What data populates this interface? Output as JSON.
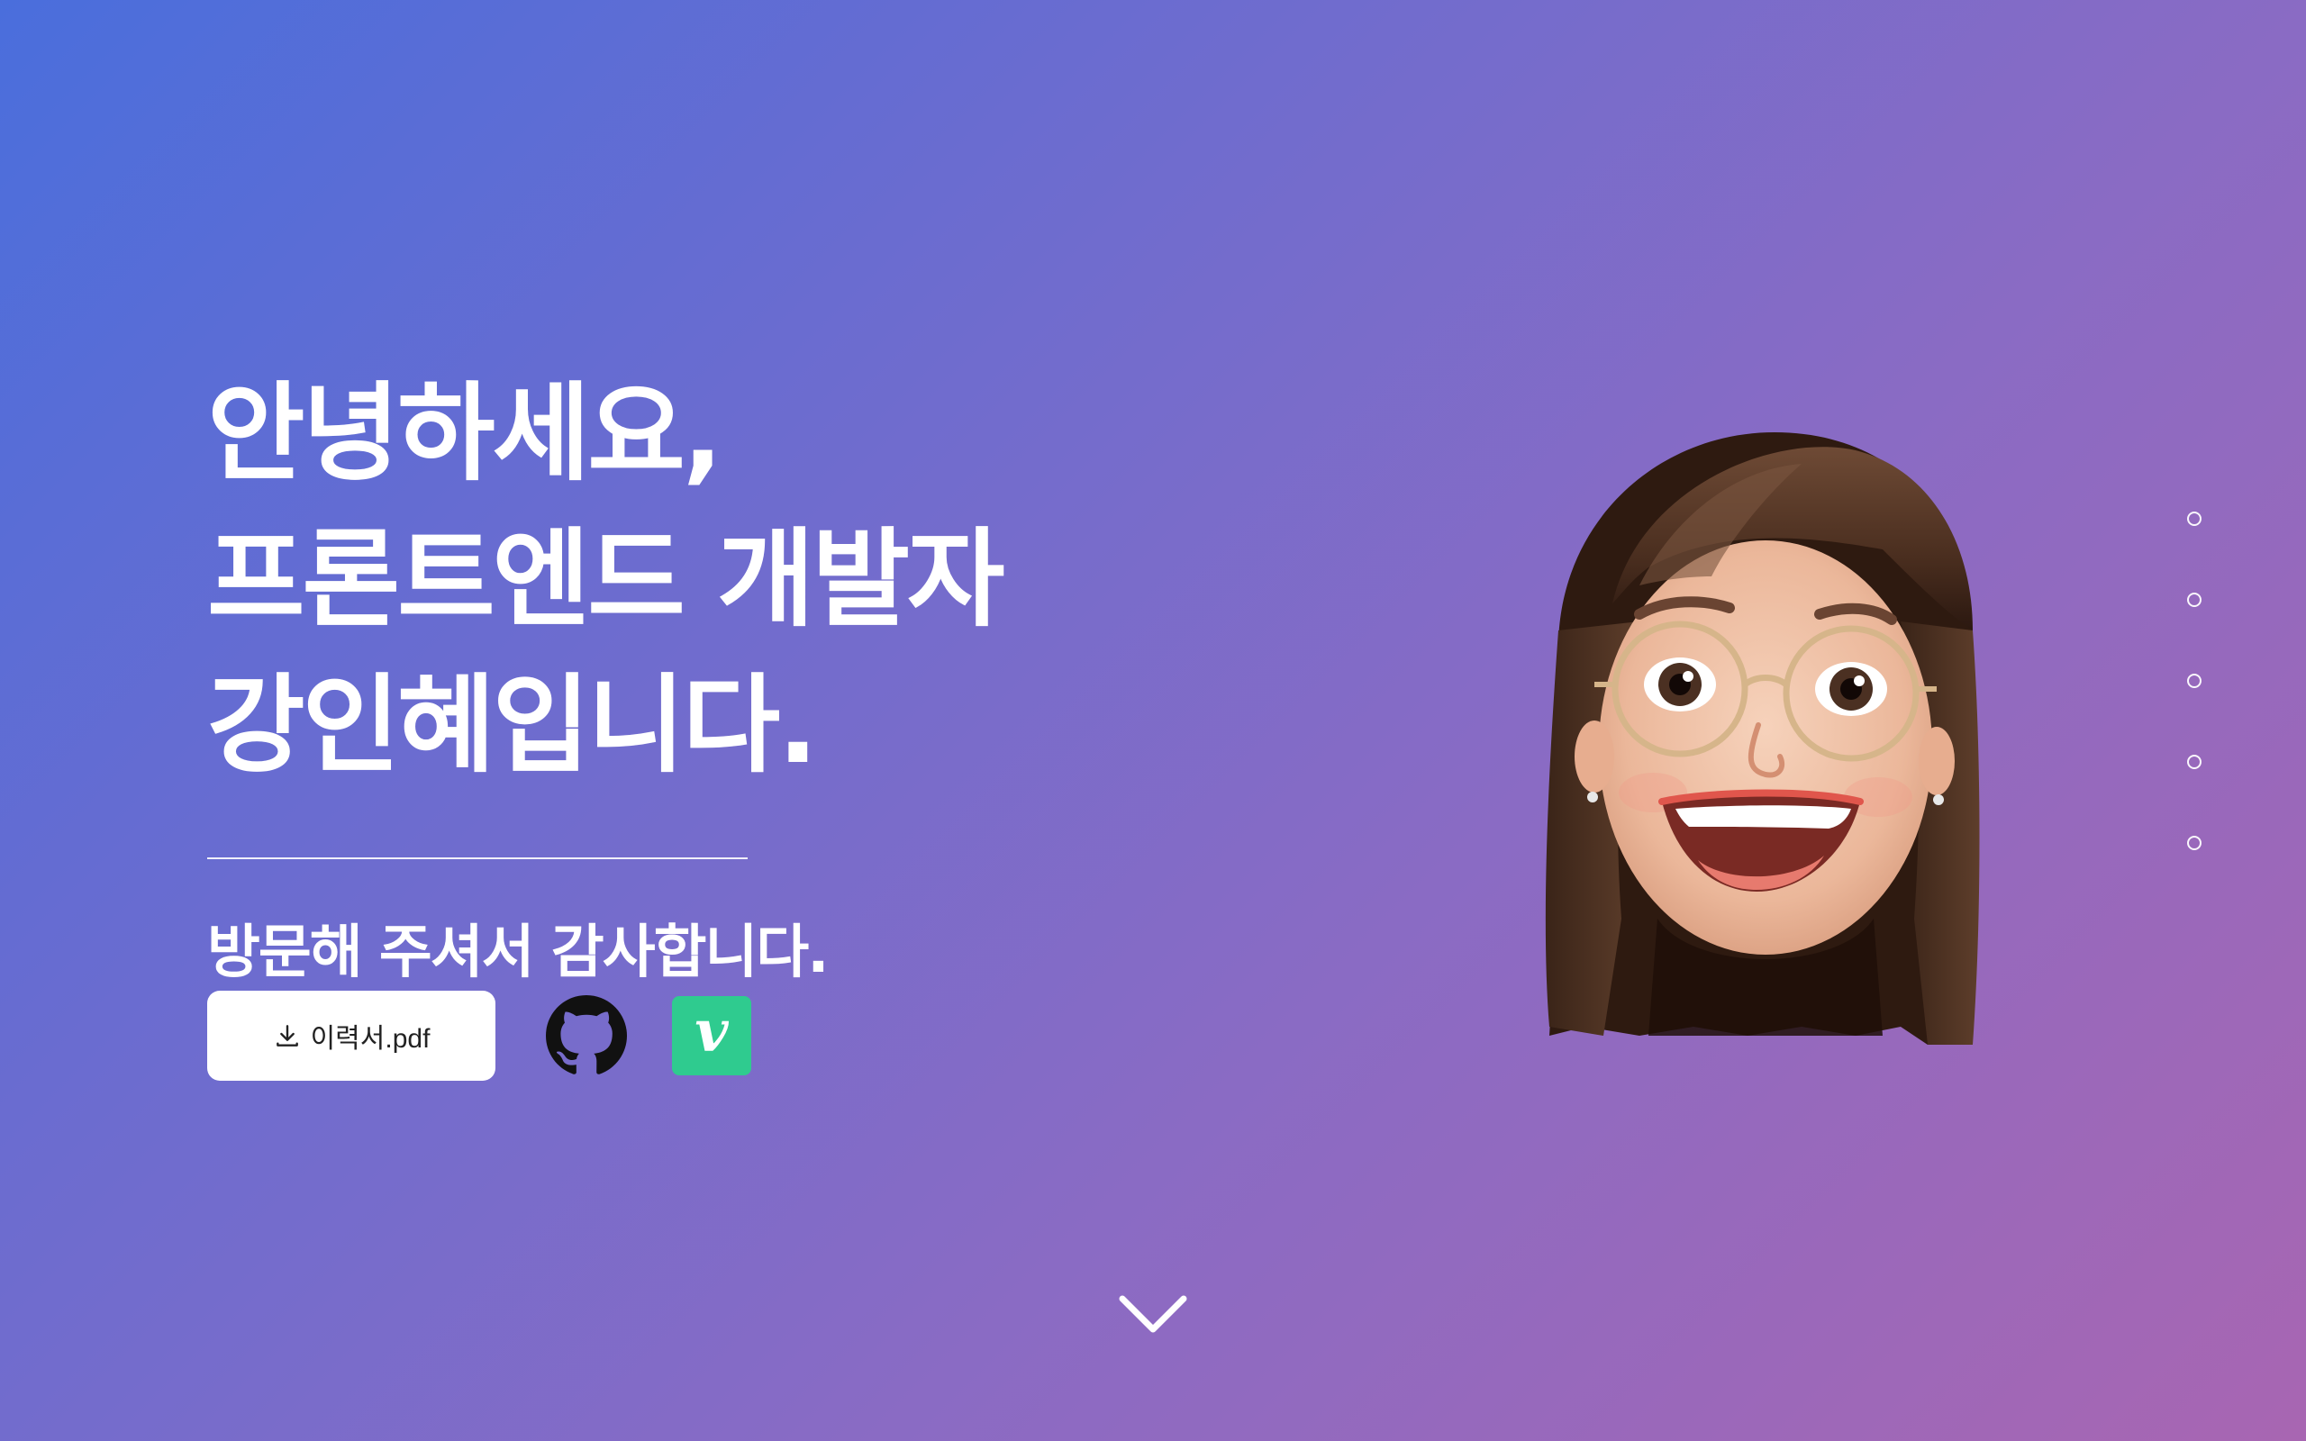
{
  "hero": {
    "greeting_lines": [
      "안녕하세요,",
      "프론트엔드 개발자",
      "강인혜입니다."
    ],
    "subtitle": "방문해 주셔서 감사합니다."
  },
  "actions": {
    "resume_label": "이력서.pdf",
    "resume_icon": "download-icon",
    "github_icon": "github-icon",
    "velog_letter": "v",
    "velog_color": "#2fcb8f"
  },
  "avatar": {
    "icon": "memoji-avatar"
  },
  "section_nav": {
    "dots": 5
  },
  "scroll_hint": {
    "icon": "chevron-down-icon"
  },
  "colors": {
    "gradient_start": "#4a6edc",
    "gradient_end": "#a866b2",
    "text": "#ffffff",
    "button_bg": "#ffffff",
    "button_text": "#222222"
  }
}
